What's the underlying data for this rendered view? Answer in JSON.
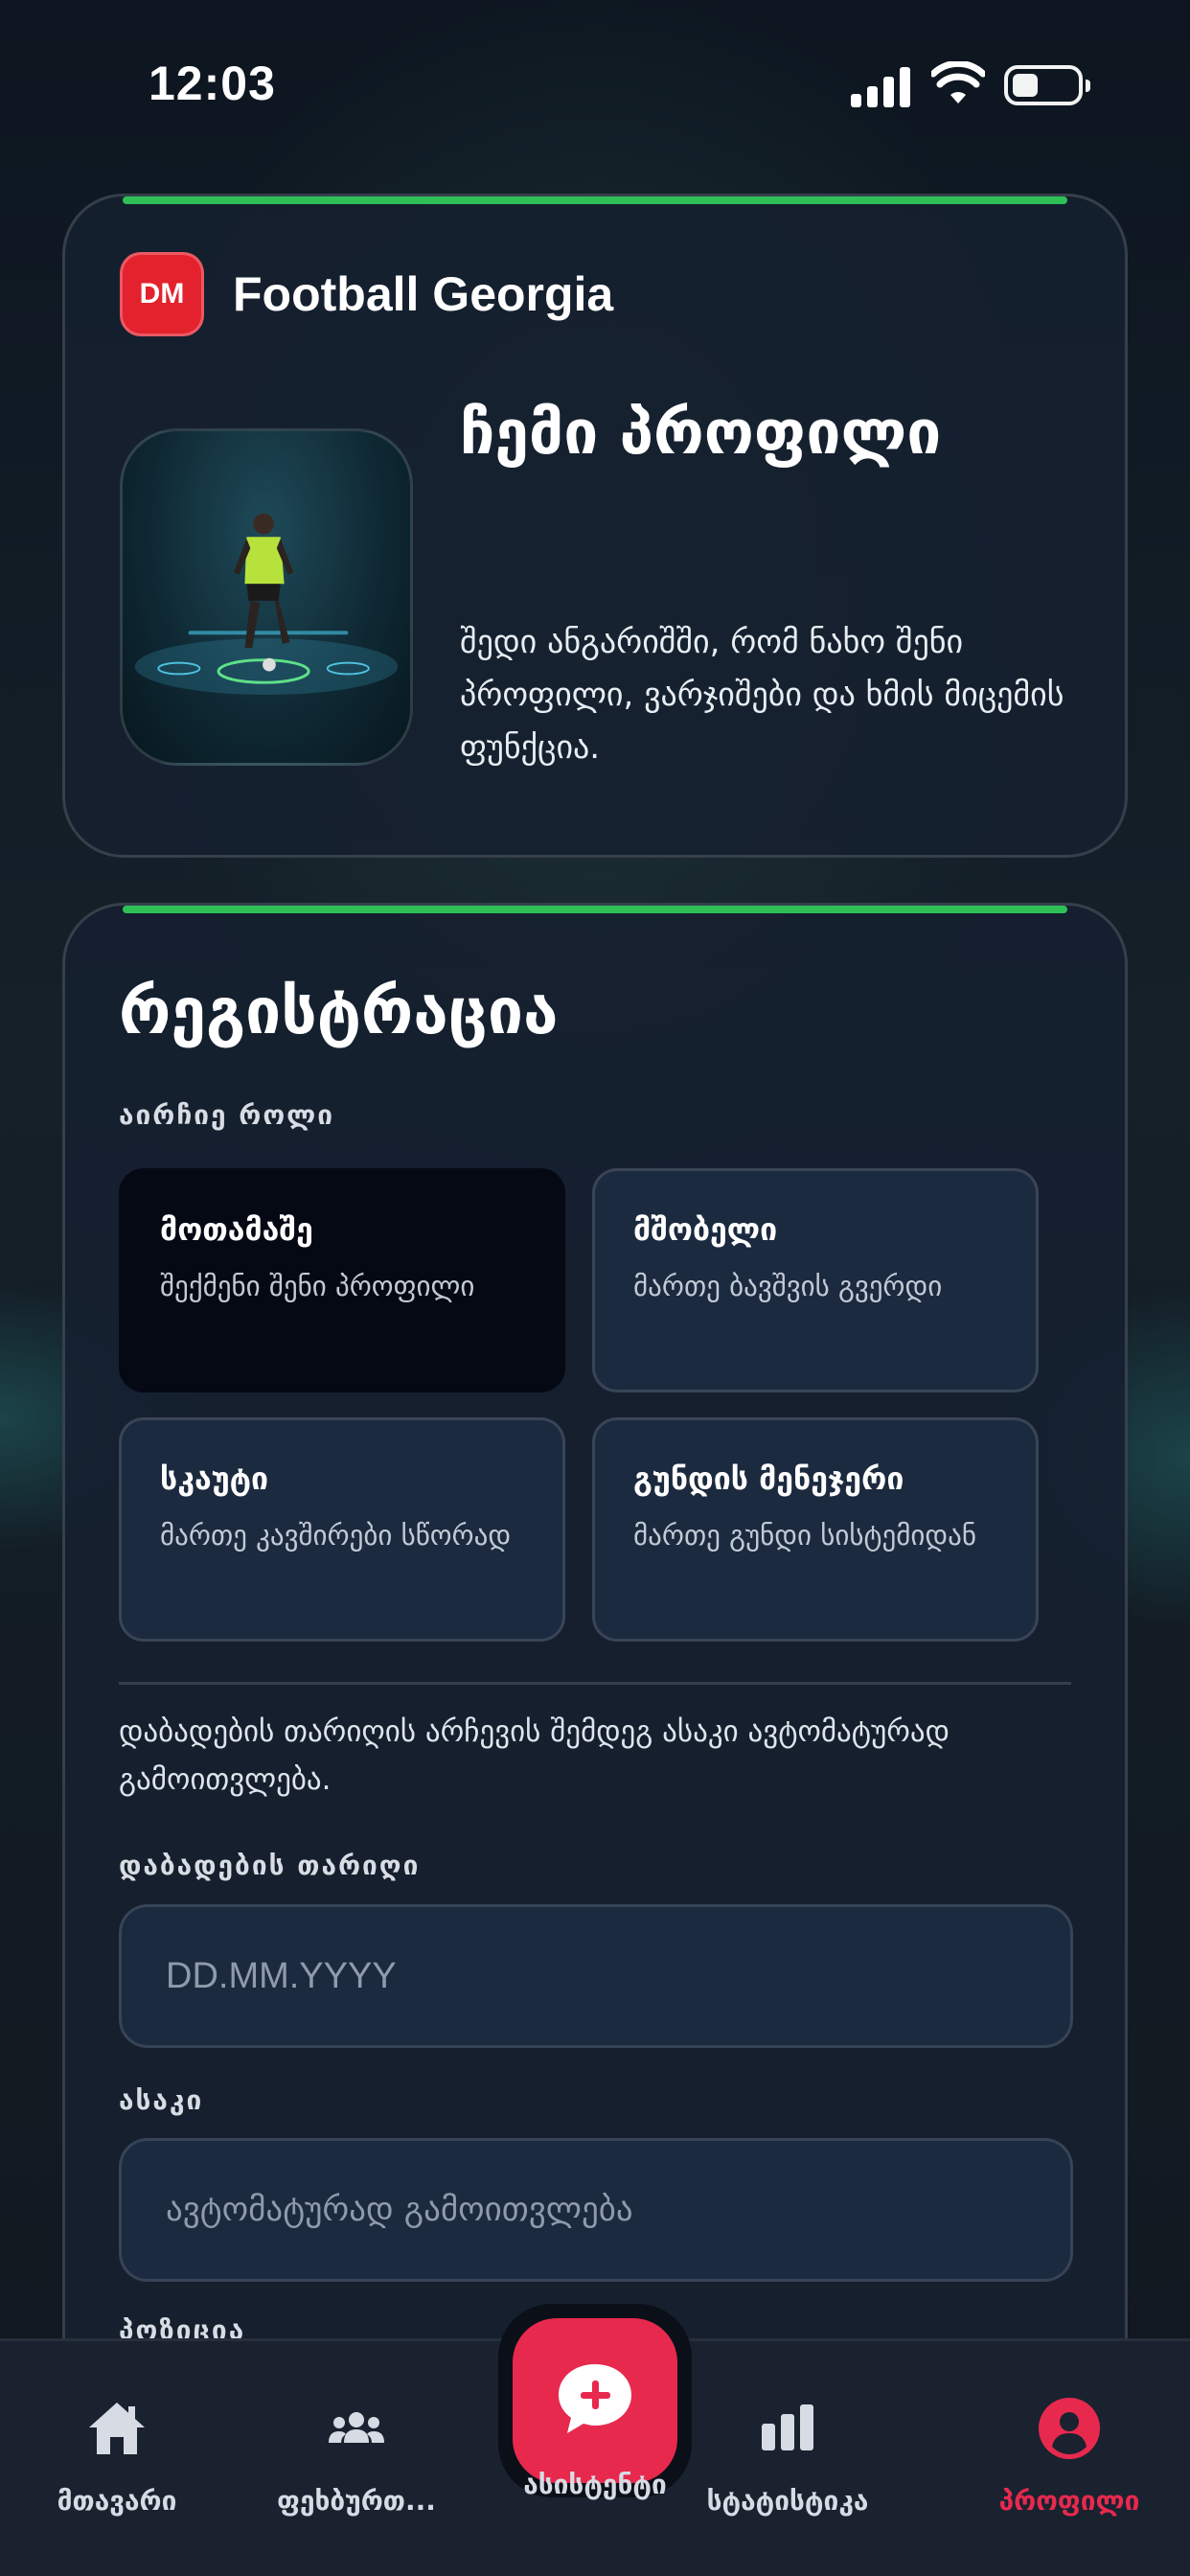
{
  "status_bar": {
    "time": "12:03"
  },
  "profile_card": {
    "brand_badge": "DM",
    "brand_name": "Football Georgia",
    "title": "ჩემი პროფილი",
    "description": "შედი ანგარიშში, რომ ნახო შენი პროფილი, ვარჯიშები და ხმის მიცემის ფუნქცია."
  },
  "registration": {
    "title": "რეგისტრაცია",
    "role_label": "აირჩიე როლი",
    "roles": [
      {
        "name": "მოთამაშე",
        "desc": "შექმენი შენი პროფილი",
        "selected": true
      },
      {
        "name": "მშობელი",
        "desc": "მართე ბავშვის გვერდი",
        "selected": false
      },
      {
        "name": "სკაუტი",
        "desc": "მართე კავშირები სწორად",
        "selected": false
      },
      {
        "name": "გუნდის მენეჯერი",
        "desc": "მართე გუნდი სისტემიდან",
        "selected": false
      }
    ],
    "note": "დაბადების თარიღის არჩევის შემდეგ ასაკი ავტომატურად გამოითვლება.",
    "birthdate_label": "დაბადების თარიღი",
    "birthdate_placeholder": "DD.MM.YYYY",
    "age_label": "ასაკი",
    "age_placeholder": "ავტომატურად გამოითვლება",
    "position_label": "პოზიცია"
  },
  "tab_bar": {
    "tabs": [
      {
        "label": "მთავარი",
        "icon": "home-icon"
      },
      {
        "label": "ფეხბურთ...",
        "icon": "users-icon"
      },
      {
        "label": "ასისტენტი",
        "icon": "chat-plus-icon"
      },
      {
        "label": "სტატისტიკა",
        "icon": "bar-chart-icon"
      },
      {
        "label": "პროფილი",
        "icon": "user-icon",
        "active": true
      }
    ]
  },
  "colors": {
    "accent": "#e8294e",
    "progress_line": "#2ec057",
    "brand_badge": "#e3222e"
  }
}
